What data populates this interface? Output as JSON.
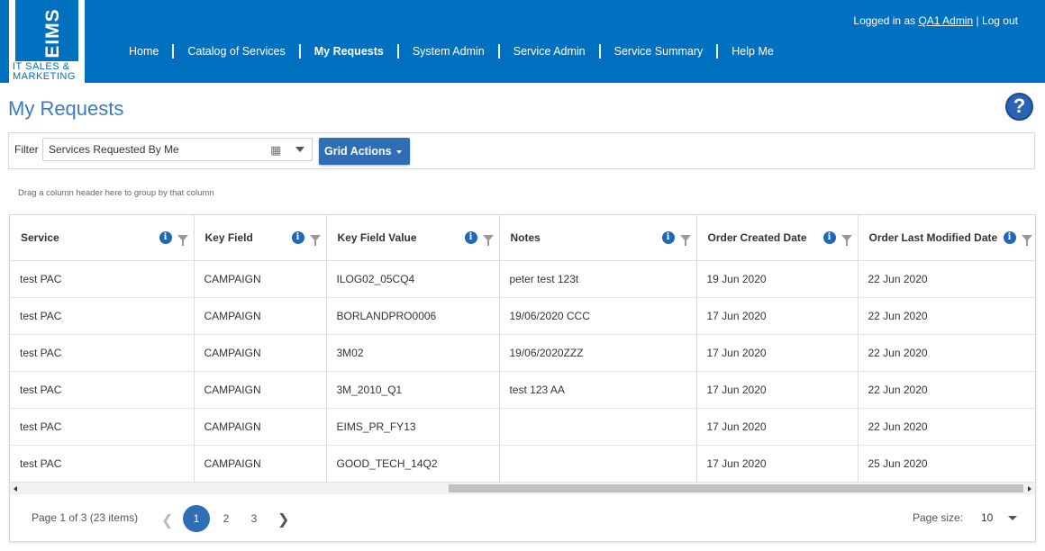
{
  "logo": {
    "main": "EIMS",
    "sub_line1": "IT SALES &",
    "sub_line2": "MARKETING"
  },
  "nav": [
    {
      "label": "Home",
      "active": false
    },
    {
      "label": "Catalog of Services",
      "active": false
    },
    {
      "label": "My Requests",
      "active": true
    },
    {
      "label": "System Admin",
      "active": false
    },
    {
      "label": "Service Admin",
      "active": false
    },
    {
      "label": "Service Summary",
      "active": false
    },
    {
      "label": "Help Me",
      "active": false
    }
  ],
  "user": {
    "prefix": "Logged in as ",
    "name": "QA1 Admin",
    "separator": " | ",
    "logout": "Log out"
  },
  "page": {
    "title": "My Requests",
    "help": "?"
  },
  "filter": {
    "label": "Filter",
    "value": "Services Requested By Me",
    "grid_actions": "Grid Actions"
  },
  "group_hint": "Drag a column header here to group by that column",
  "columns": [
    {
      "label": "Service",
      "width": 204
    },
    {
      "label": "Key Field",
      "width": 147
    },
    {
      "label": "Key Field Value",
      "width": 192
    },
    {
      "label": "Notes",
      "width": 219
    },
    {
      "label": "Order Created Date",
      "width": 179
    },
    {
      "label": "Order Last Modified Date",
      "width": 200
    }
  ],
  "rows": [
    [
      "test PAC",
      "CAMPAIGN",
      "ILOG02_05CQ4",
      "peter test 123t",
      "19 Jun 2020",
      "22 Jun 2020"
    ],
    [
      "test PAC",
      "CAMPAIGN",
      "BORLANDPRO0006",
      "19/06/2020 CCC",
      "17 Jun 2020",
      "22 Jun 2020"
    ],
    [
      "test PAC",
      "CAMPAIGN",
      "3M02",
      "19/06/2020ZZZ",
      "17 Jun 2020",
      "22 Jun 2020"
    ],
    [
      "test PAC",
      "CAMPAIGN",
      "3M_2010_Q1",
      "test 123 AA",
      "17 Jun 2020",
      "22 Jun 2020"
    ],
    [
      "test PAC",
      "CAMPAIGN",
      "EIMS_PR_FY13",
      "",
      "17 Jun 2020",
      "22 Jun 2020"
    ],
    [
      "test PAC",
      "CAMPAIGN",
      "GOOD_TECH_14Q2",
      "",
      "17 Jun 2020",
      "25 Jun 2020"
    ]
  ],
  "pager": {
    "info": "Page 1 of 3 (23 items)",
    "pages": [
      "1",
      "2",
      "3"
    ],
    "current": "1",
    "page_size_label": "Page size:",
    "page_size_value": "10"
  }
}
